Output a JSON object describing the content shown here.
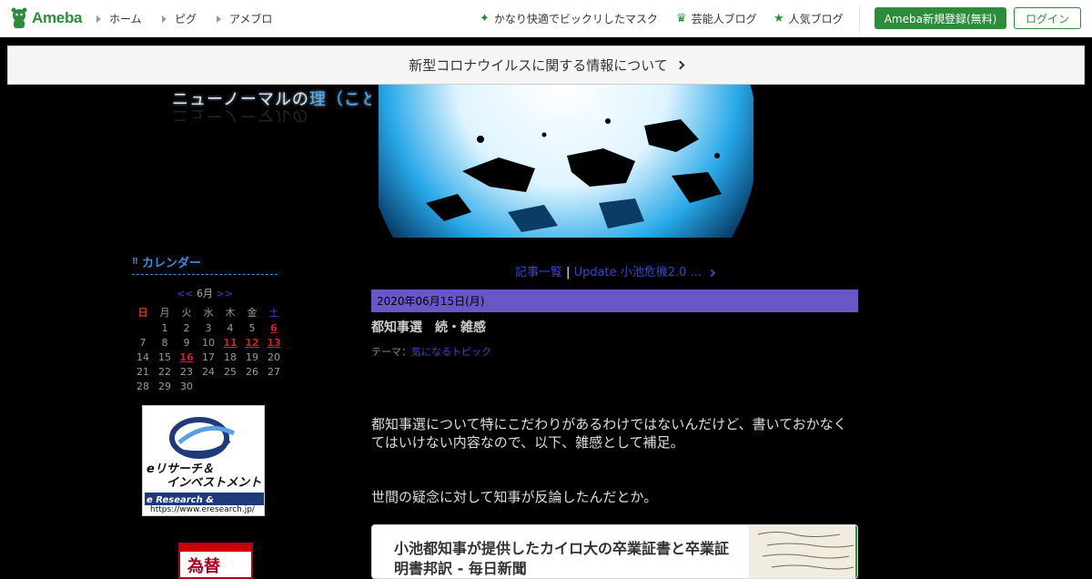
{
  "topbar": {
    "logo_text": "Ameba",
    "nav": [
      {
        "label": "ホーム"
      },
      {
        "label": "ピグ"
      },
      {
        "label": "アメブロ"
      }
    ],
    "right_links": [
      {
        "label": "かなり快適でビックリしたマスク",
        "icon": "sparkle-icon"
      },
      {
        "label": "芸能人ブログ",
        "icon": "crown-icon"
      },
      {
        "label": "人気ブログ",
        "icon": "star-icon"
      }
    ],
    "register_label": "Ameba新規登録(無料)",
    "login_label": "ログイン",
    "accent": "#2d8c3c"
  },
  "covid_banner": {
    "text": "新型コロナウイルスに関する情報について"
  },
  "header": {
    "title_prefix": "ニューノーマルの",
    "title_highlight": "理",
    "title_suffix": "（ことわり）"
  },
  "sidebar": {
    "calendar_title": "カレンダー",
    "prev": "<<",
    "month": "6月",
    "next": ">>",
    "weekdays": [
      "日",
      "月",
      "火",
      "水",
      "木",
      "金",
      "土"
    ],
    "weeks": [
      [
        "",
        "1",
        "2",
        "3",
        "4",
        "5",
        "6"
      ],
      [
        "7",
        "8",
        "9",
        "10",
        "11",
        "12",
        "13"
      ],
      [
        "14",
        "15",
        "16",
        "17",
        "18",
        "19",
        "20"
      ],
      [
        "21",
        "22",
        "23",
        "24",
        "25",
        "26",
        "27"
      ],
      [
        "28",
        "29",
        "30",
        "",
        "",
        "",
        ""
      ]
    ],
    "linked_days": [
      "6",
      "11",
      "12",
      "13",
      "16"
    ],
    "ad1": {
      "line1": "eリサーチ＆",
      "line2": "インベストメント",
      "line3": "e Research & Investment",
      "url": "https://www.eresearch.jp/"
    },
    "ad2": {
      "text": "為替"
    }
  },
  "entry": {
    "list_link": "記事一覧",
    "separator": "|",
    "next_link": "Update  小池危機2.0 ...",
    "date": "2020年06月15日(月)",
    "title": "都知事選　続・雑感",
    "theme_label": "テーマ：",
    "theme_value": "気になるトピック",
    "para1": "都知事選について特にこだわりがあるわけではないんだけど、書いておかなくてはいけない内容なので、以下、雑感として補足。",
    "para2": "世間の疑念に対して知事が反論したんだとか。",
    "card_title": "小池都知事が提供したカイロ大の卒業証書と卒業証明書邦訳 - 毎日新聞"
  },
  "colors": {
    "date_bar": "#6a56c7",
    "link": "#3a46c8",
    "calendar_head": "#3b8fd8"
  }
}
